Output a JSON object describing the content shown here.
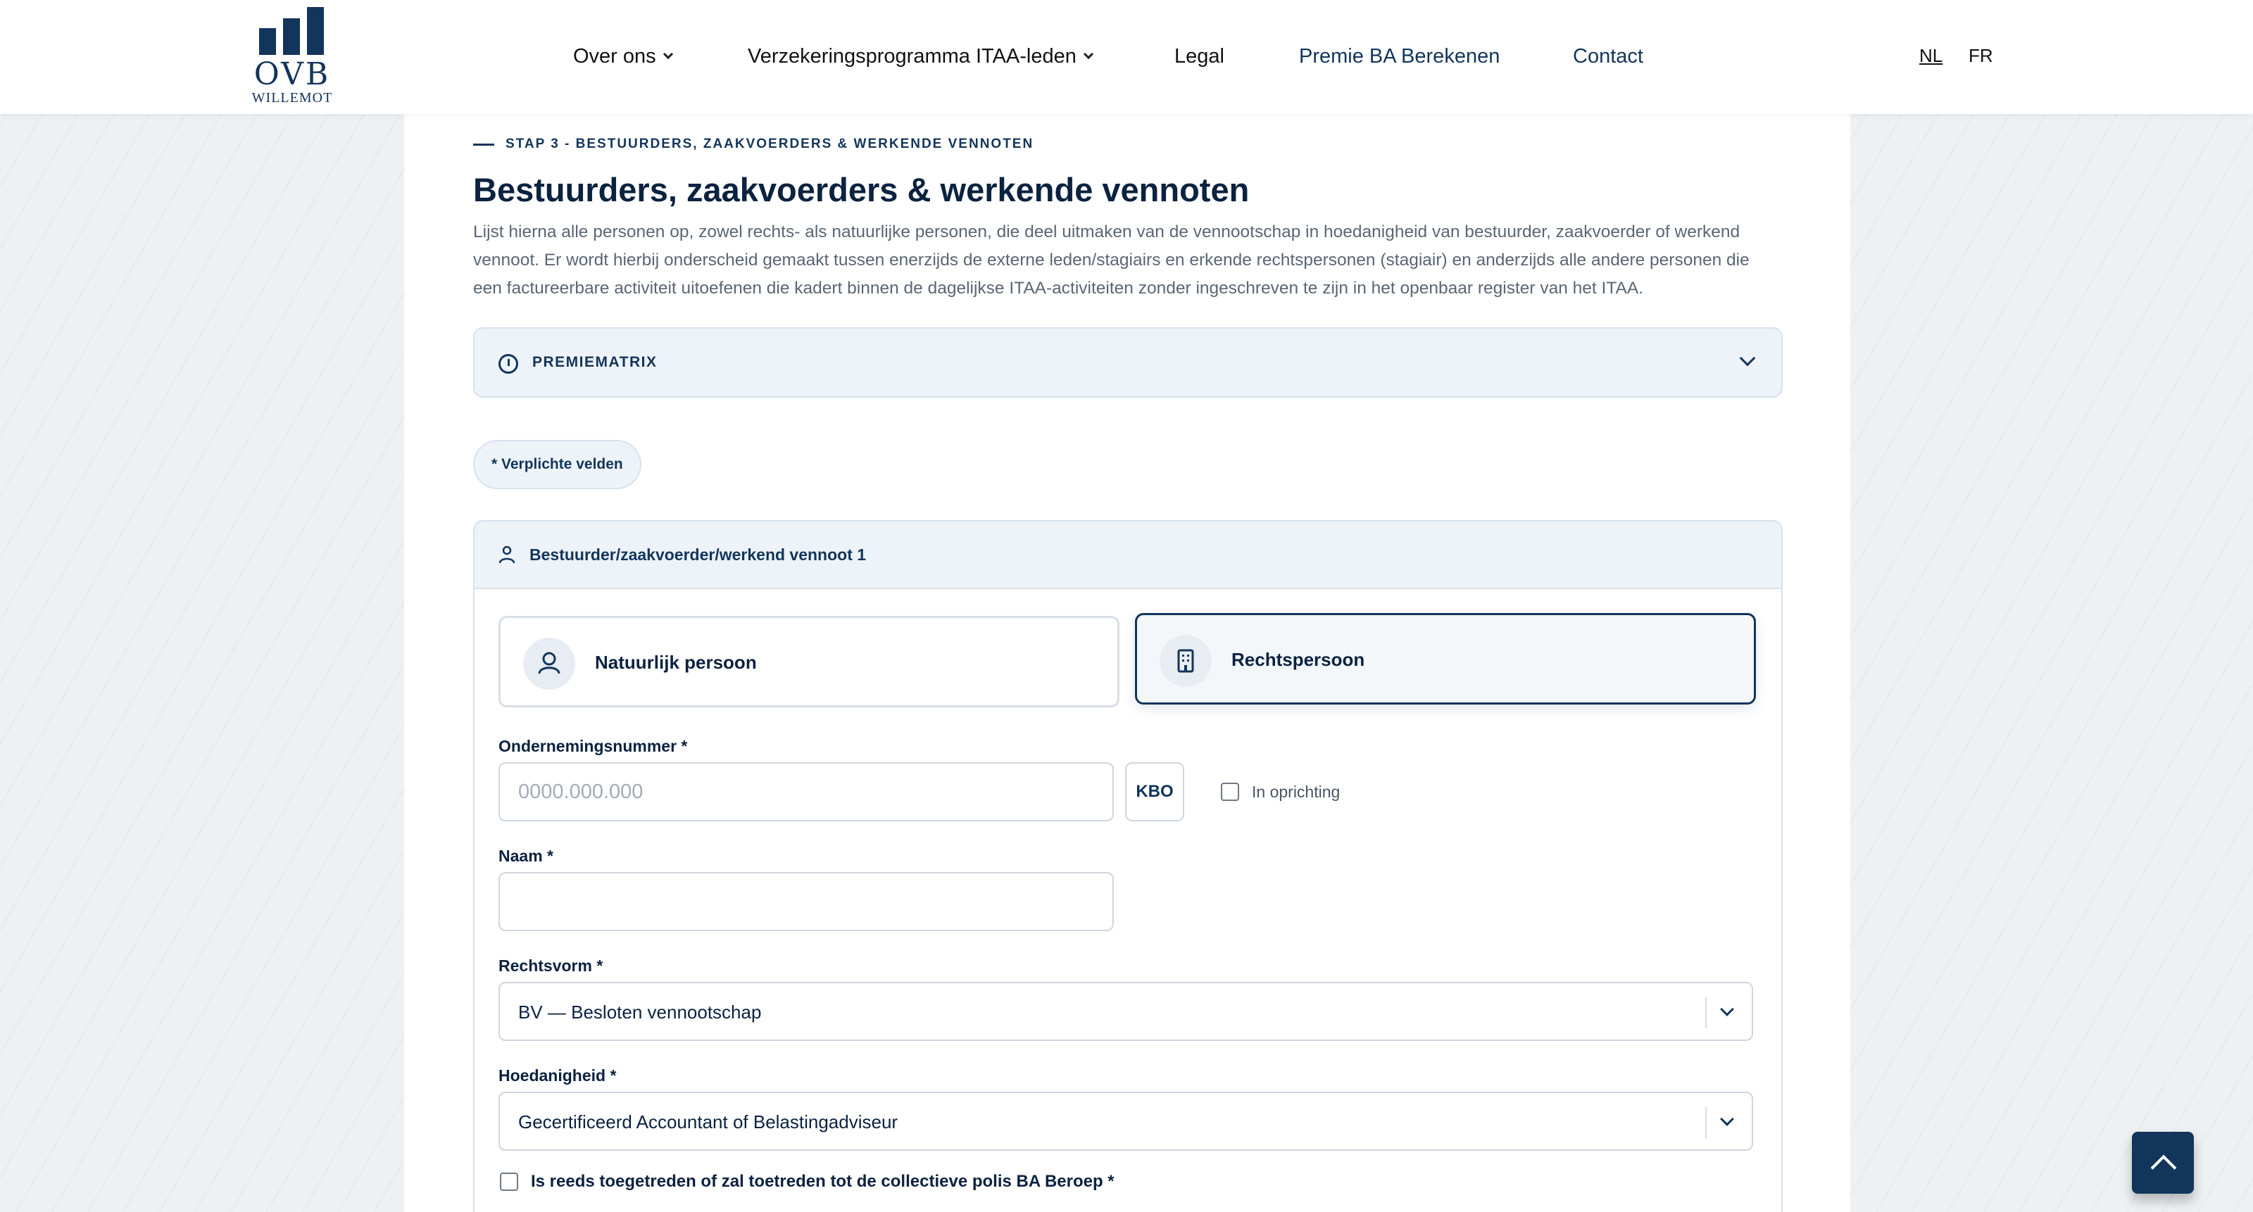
{
  "brand": {
    "name": "OVB",
    "subtitle": "WILLEMOT"
  },
  "nav": {
    "items": [
      {
        "label": "Over ons",
        "has_dropdown": true
      },
      {
        "label": "Verzekeringsprogramma ITAA-leden",
        "has_dropdown": true
      },
      {
        "label": "Legal",
        "has_dropdown": false
      },
      {
        "label": "Premie BA Berekenen",
        "has_dropdown": false
      },
      {
        "label": "Contact",
        "has_dropdown": false
      }
    ],
    "languages": [
      {
        "label": "NL",
        "active": true
      },
      {
        "label": "FR",
        "active": false
      }
    ]
  },
  "main": {
    "step": "STAP 3 - BESTUURDERS, ZAAKVOERDERS & WERKENDE VENNOTEN",
    "title": "Bestuurders, zaakvoerders & werkende vennoten",
    "intro": "Lijst hierna alle personen op, zowel rechts- als natuurlijke personen, die deel uitmaken van de vennootschap in hoedanigheid van bestuurder, zaakvoerder of werkend vennoot. Er wordt hierbij onderscheid gemaakt tussen enerzijds de externe leden/stagiairs en erkende rechtspersonen (stagiair) en anderzijds alle andere personen die een factureerbare activiteit uitoefenen die kadert binnen de dagelijkse ITAA-activiteiten zonder ingeschreven te zijn in het openbaar register van het ITAA.",
    "premiematrix": "PREMIEMATRIX",
    "required_note": "* Verplichte velden",
    "card": {
      "title": "Bestuurder/zaakvoerder/werkend vennoot 1",
      "options": [
        {
          "label": "Natuurlijk persoon",
          "icon": "user-icon",
          "selected": false
        },
        {
          "label": "Rechtspersoon",
          "icon": "building-icon",
          "selected": true
        }
      ],
      "company_number": {
        "label": "Ondernemingsnummer *",
        "placeholder": "0000.000.000",
        "value": "",
        "kbo_label": "KBO",
        "in_oprichting_label": "In oprichting"
      },
      "name": {
        "label": "Naam *",
        "value": ""
      },
      "legal_form": {
        "label": "Rechtsvorm *",
        "value": "BV — Besloten vennootschap"
      },
      "capacity": {
        "label": "Hoedanigheid *",
        "value": "Gecertificeerd Accountant of Belastingadviseur"
      },
      "collective_policy": {
        "label": "Is reeds toegetreden of zal toetreden tot de collectieve polis BA Beroep *"
      }
    }
  },
  "colors": {
    "primary": "#12355b",
    "panel_bg": "#eef3f9",
    "border": "#d7e2ee"
  }
}
